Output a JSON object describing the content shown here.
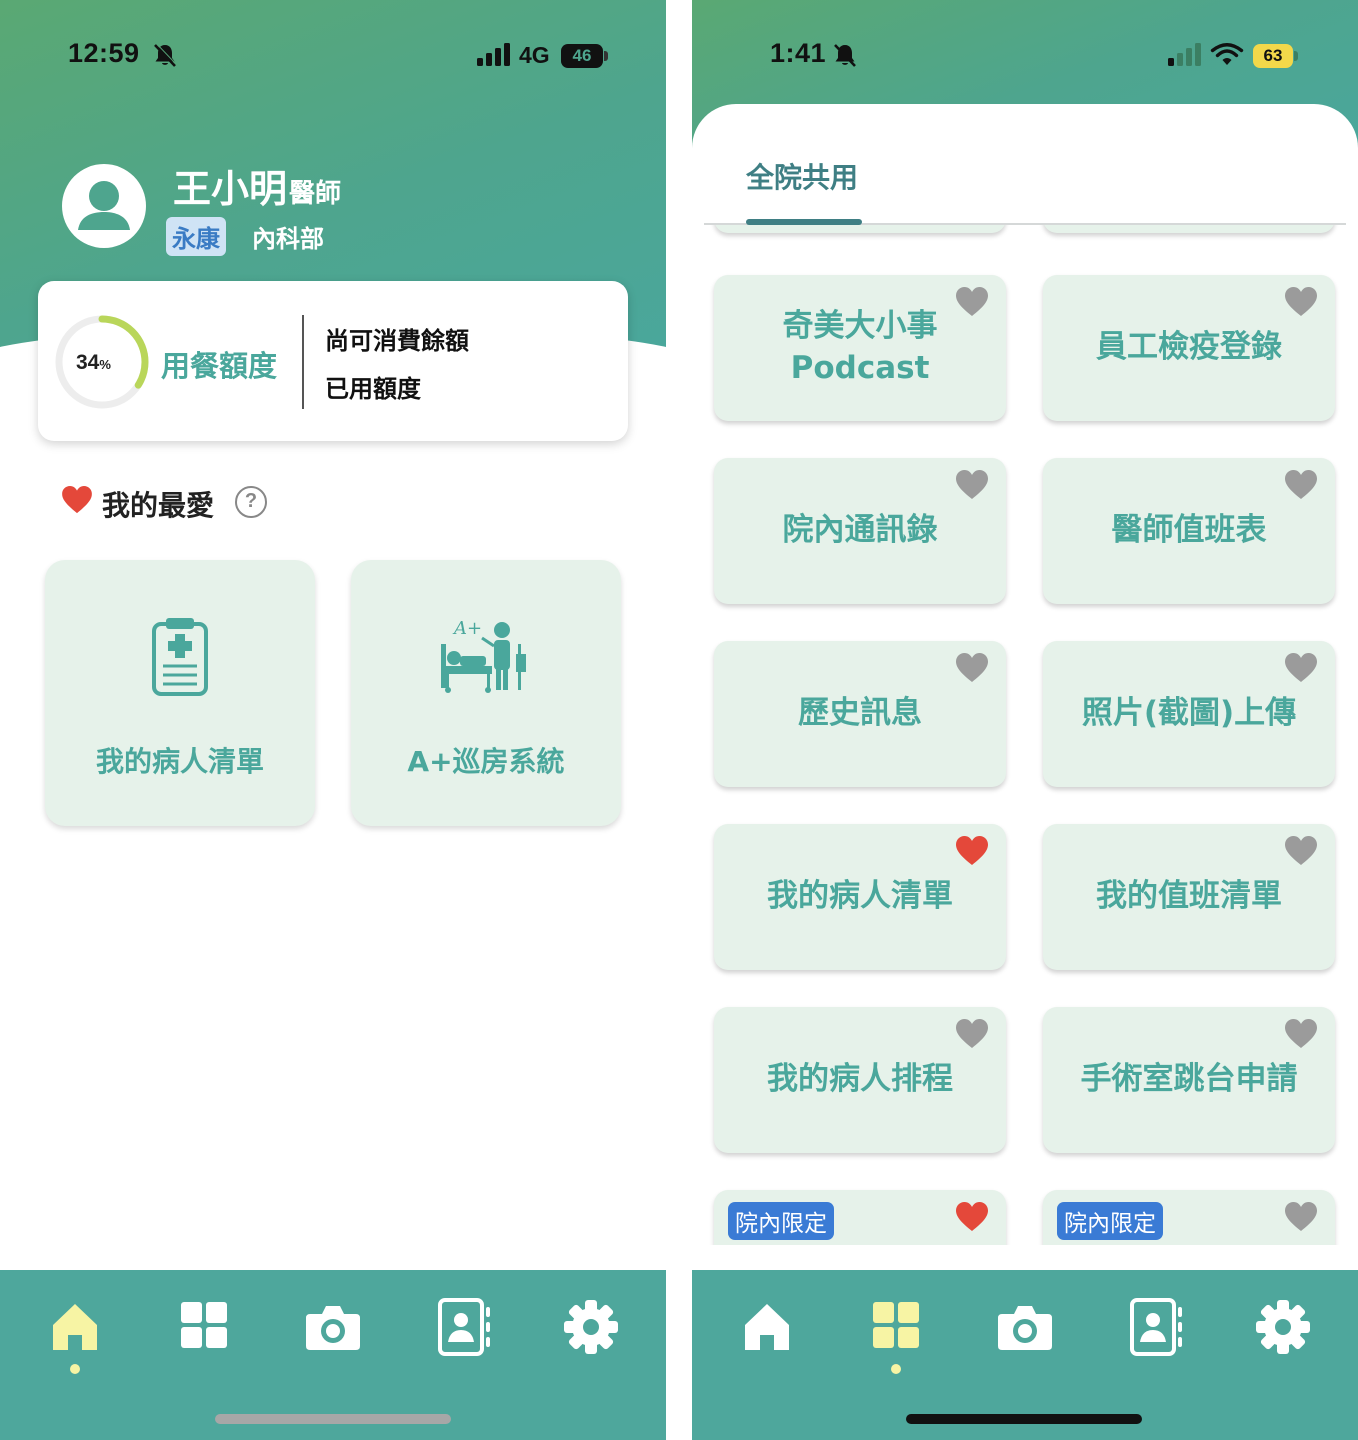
{
  "left": {
    "status": {
      "time": "12:59",
      "network": "4G",
      "battery": "46"
    },
    "profile": {
      "name": "王小明",
      "title_suffix": "醫師",
      "campus": "永康",
      "department": "內科部"
    },
    "meal": {
      "percent": "34",
      "percent_sign": "%",
      "progress": 0.34,
      "label": "用餐額度",
      "remaining_label": "尚可消費餘額",
      "used_label": "已用額度"
    },
    "favorites": {
      "title": "我的最愛",
      "help": "?",
      "items": [
        {
          "label": "我的病人清單",
          "icon": "clipboard-medical-icon"
        },
        {
          "label": "A+巡房系統",
          "icon": "ward-round-icon"
        }
      ]
    },
    "tabbar": {
      "active": "home",
      "tabs": [
        "home",
        "grid",
        "camera",
        "contacts",
        "settings"
      ]
    }
  },
  "right": {
    "status": {
      "time": "1:41",
      "battery": "63"
    },
    "tab_title": "全院共用",
    "services": [
      {
        "label_line1": "奇美大小事",
        "label_line2": "Podcast",
        "favorite": false
      },
      {
        "label_line1": "員工檢疫登錄",
        "label_line2": "",
        "favorite": false
      },
      {
        "label_line1": "院內通訊錄",
        "label_line2": "",
        "favorite": false
      },
      {
        "label_line1": "醫師值班表",
        "label_line2": "",
        "favorite": false
      },
      {
        "label_line1": "歷史訊息",
        "label_line2": "",
        "favorite": false
      },
      {
        "label_line1": "照片(截圖)上傳",
        "label_line2": "",
        "favorite": false
      },
      {
        "label_line1": "我的病人清單",
        "label_line2": "",
        "favorite": true
      },
      {
        "label_line1": "我的值班清單",
        "label_line2": "",
        "favorite": false
      },
      {
        "label_line1": "我的病人排程",
        "label_line2": "",
        "favorite": false
      },
      {
        "label_line1": "手術室跳台申請",
        "label_line2": "",
        "favorite": false
      },
      {
        "badge": "院內限定",
        "favorite": true
      },
      {
        "badge": "院內限定",
        "favorite": false
      }
    ],
    "tabbar": {
      "active": "grid",
      "tabs": [
        "home",
        "grid",
        "camera",
        "contacts",
        "settings"
      ]
    }
  },
  "colors": {
    "primary": "#4ea79c",
    "card": "#e6f2ea",
    "accent_yellow": "#f7f4a4",
    "heart_red": "#e4483a",
    "heart_gray": "#9b9b9b",
    "badge_blue": "#3a7bd5",
    "progress_green": "#b9d65a"
  }
}
